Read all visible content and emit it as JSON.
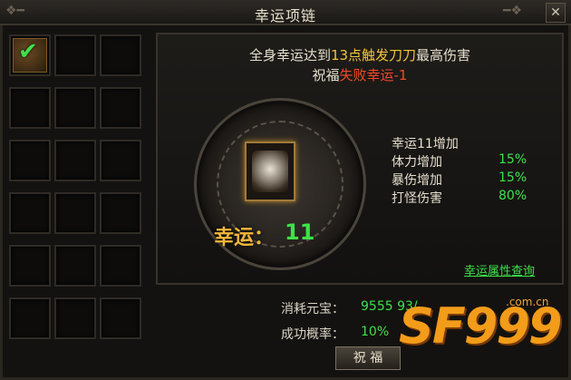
{
  "window": {
    "title": "幸运项链",
    "close_label": "✕"
  },
  "inventory": {
    "rows": 6,
    "cols": 3,
    "first_slot_has_item": true,
    "first_slot_checked": true
  },
  "panel": {
    "desc_line1_pre": "全身幸运达到",
    "desc_line1_highlight": "13点触发刀刀",
    "desc_line1_post": "最高伤害",
    "desc_line2_pre": "祝福",
    "desc_line2_red": "失败幸运-1",
    "luck_label": "幸运：",
    "luck_value": "11",
    "stats_title": "幸运11增加",
    "stats": [
      {
        "label": "体力增加",
        "value": "15%"
      },
      {
        "label": "暴伤增加",
        "value": "15%"
      },
      {
        "label": "打怪伤害",
        "value": "80%"
      }
    ],
    "attr_link": "幸运属性查询"
  },
  "footer": {
    "cost_label": "消耗元宝：",
    "cost_value": "9555 93/",
    "rate_label": "成功概率：",
    "rate_value": "10%",
    "bless_button": "祝 福"
  },
  "watermark": {
    "text": "SF999",
    "domain": ".com.cn"
  },
  "colors": {
    "accent_green": "#3ee14a",
    "accent_yellow": "#f2c33a",
    "accent_red": "#ee4a2a"
  }
}
